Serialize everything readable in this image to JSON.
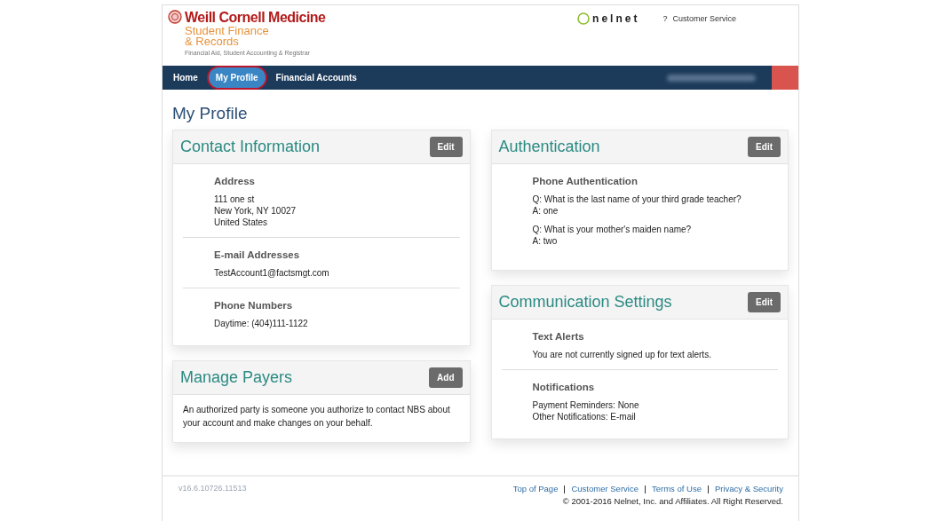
{
  "header": {
    "brand": "Weill Cornell Medicine",
    "subtitle_lines": [
      "Student Finance",
      "& Records"
    ],
    "tagline": "Financial Aid, Student Accounting & Registrar",
    "partner_logo": "nelnet",
    "help_mark": "?",
    "help_link": "Customer Service"
  },
  "nav": [
    {
      "label": "Home",
      "selected": false
    },
    {
      "label": "My Profile",
      "selected": true
    },
    {
      "label": "Financial Accounts",
      "selected": false
    }
  ],
  "page_title": "My Profile",
  "columns": [
    [
      {
        "title": "Contact Information",
        "button": "Edit",
        "sections": [
          {
            "heading": "Address",
            "lines": [
              "111 one st",
              "New York, NY 10027",
              "United States"
            ]
          },
          {
            "heading": "E-mail Addresses",
            "lines": [
              "TestAccount1@factsmgt.com"
            ]
          },
          {
            "heading": "Phone Numbers",
            "lines": [
              "Daytime: (404)111-1122"
            ]
          }
        ]
      },
      {
        "title": "Manage Payers",
        "button": "Add",
        "text": "An authorized party is someone you authorize to contact NBS about your account and make changes on your behalf."
      }
    ],
    [
      {
        "title": "Authentication",
        "button": "Edit",
        "sections": [
          {
            "heading": "Phone Authentication",
            "groups": [
              [
                "Q: What is the last name of your third grade teacher?",
                "A: one"
              ],
              [
                "Q: What is your mother's maiden name?",
                "A: two"
              ]
            ]
          }
        ]
      },
      {
        "title": "Communication Settings",
        "button": "Edit",
        "sections": [
          {
            "heading": "Text Alerts",
            "lines": [
              "You are not currently signed up for text alerts."
            ]
          },
          {
            "heading": "Notifications",
            "lines": [
              "Payment Reminders: None",
              "Other Notifications: E-mail"
            ]
          }
        ]
      }
    ]
  ],
  "footer": {
    "version": "v16.6.10726.11513",
    "links": [
      "Top of Page",
      "Customer Service",
      "Terms of Use",
      "Privacy & Security"
    ],
    "copyright": "© 2001-2016 Nelnet, Inc. and Affiliates. All Right Reserved."
  }
}
